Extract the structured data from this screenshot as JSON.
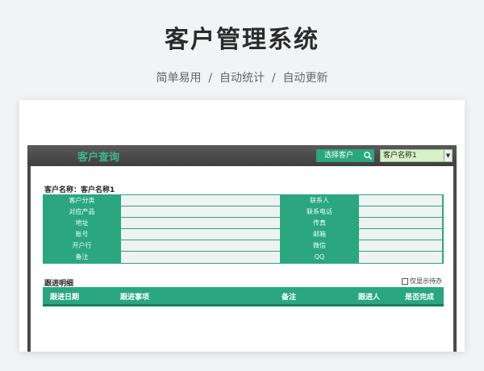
{
  "hero": {
    "title": "客户管理系统",
    "subtitle": "简单易用  /  自动统计  /  自动更新"
  },
  "toolbar": {
    "title": "客户查询",
    "select_button": "选择客户",
    "selected_customer": "客户名称1"
  },
  "customer": {
    "label": "客户名称：",
    "value": "客户名称1"
  },
  "info_rows": [
    {
      "left_label": "客户分类",
      "left_value": "",
      "right_label": "联系人",
      "right_value": ""
    },
    {
      "left_label": "对应产品",
      "left_value": "",
      "right_label": "联系电话",
      "right_value": ""
    },
    {
      "left_label": "地址",
      "left_value": "",
      "right_label": "传真",
      "right_value": ""
    },
    {
      "left_label": "账号",
      "left_value": "",
      "right_label": "邮箱",
      "right_value": ""
    },
    {
      "left_label": "开户行",
      "left_value": "",
      "right_label": "微信",
      "right_value": ""
    },
    {
      "left_label": "备注",
      "left_value": "",
      "right_label": "QQ",
      "right_value": ""
    }
  ],
  "followup": {
    "title": "跟进明细",
    "only_pending_label": "仅显示待办",
    "only_pending_checked": false,
    "columns": [
      "跟进日期",
      "跟进事项",
      "备注",
      "跟进人",
      "是否完成"
    ]
  },
  "colors": {
    "accent": "#2aa77f",
    "toolbar_bg": "#4a4a4a",
    "select_bg": "#d7f0c8"
  },
  "icons": {
    "search": "search-icon",
    "dropdown": "dropdown-arrow-icon"
  }
}
